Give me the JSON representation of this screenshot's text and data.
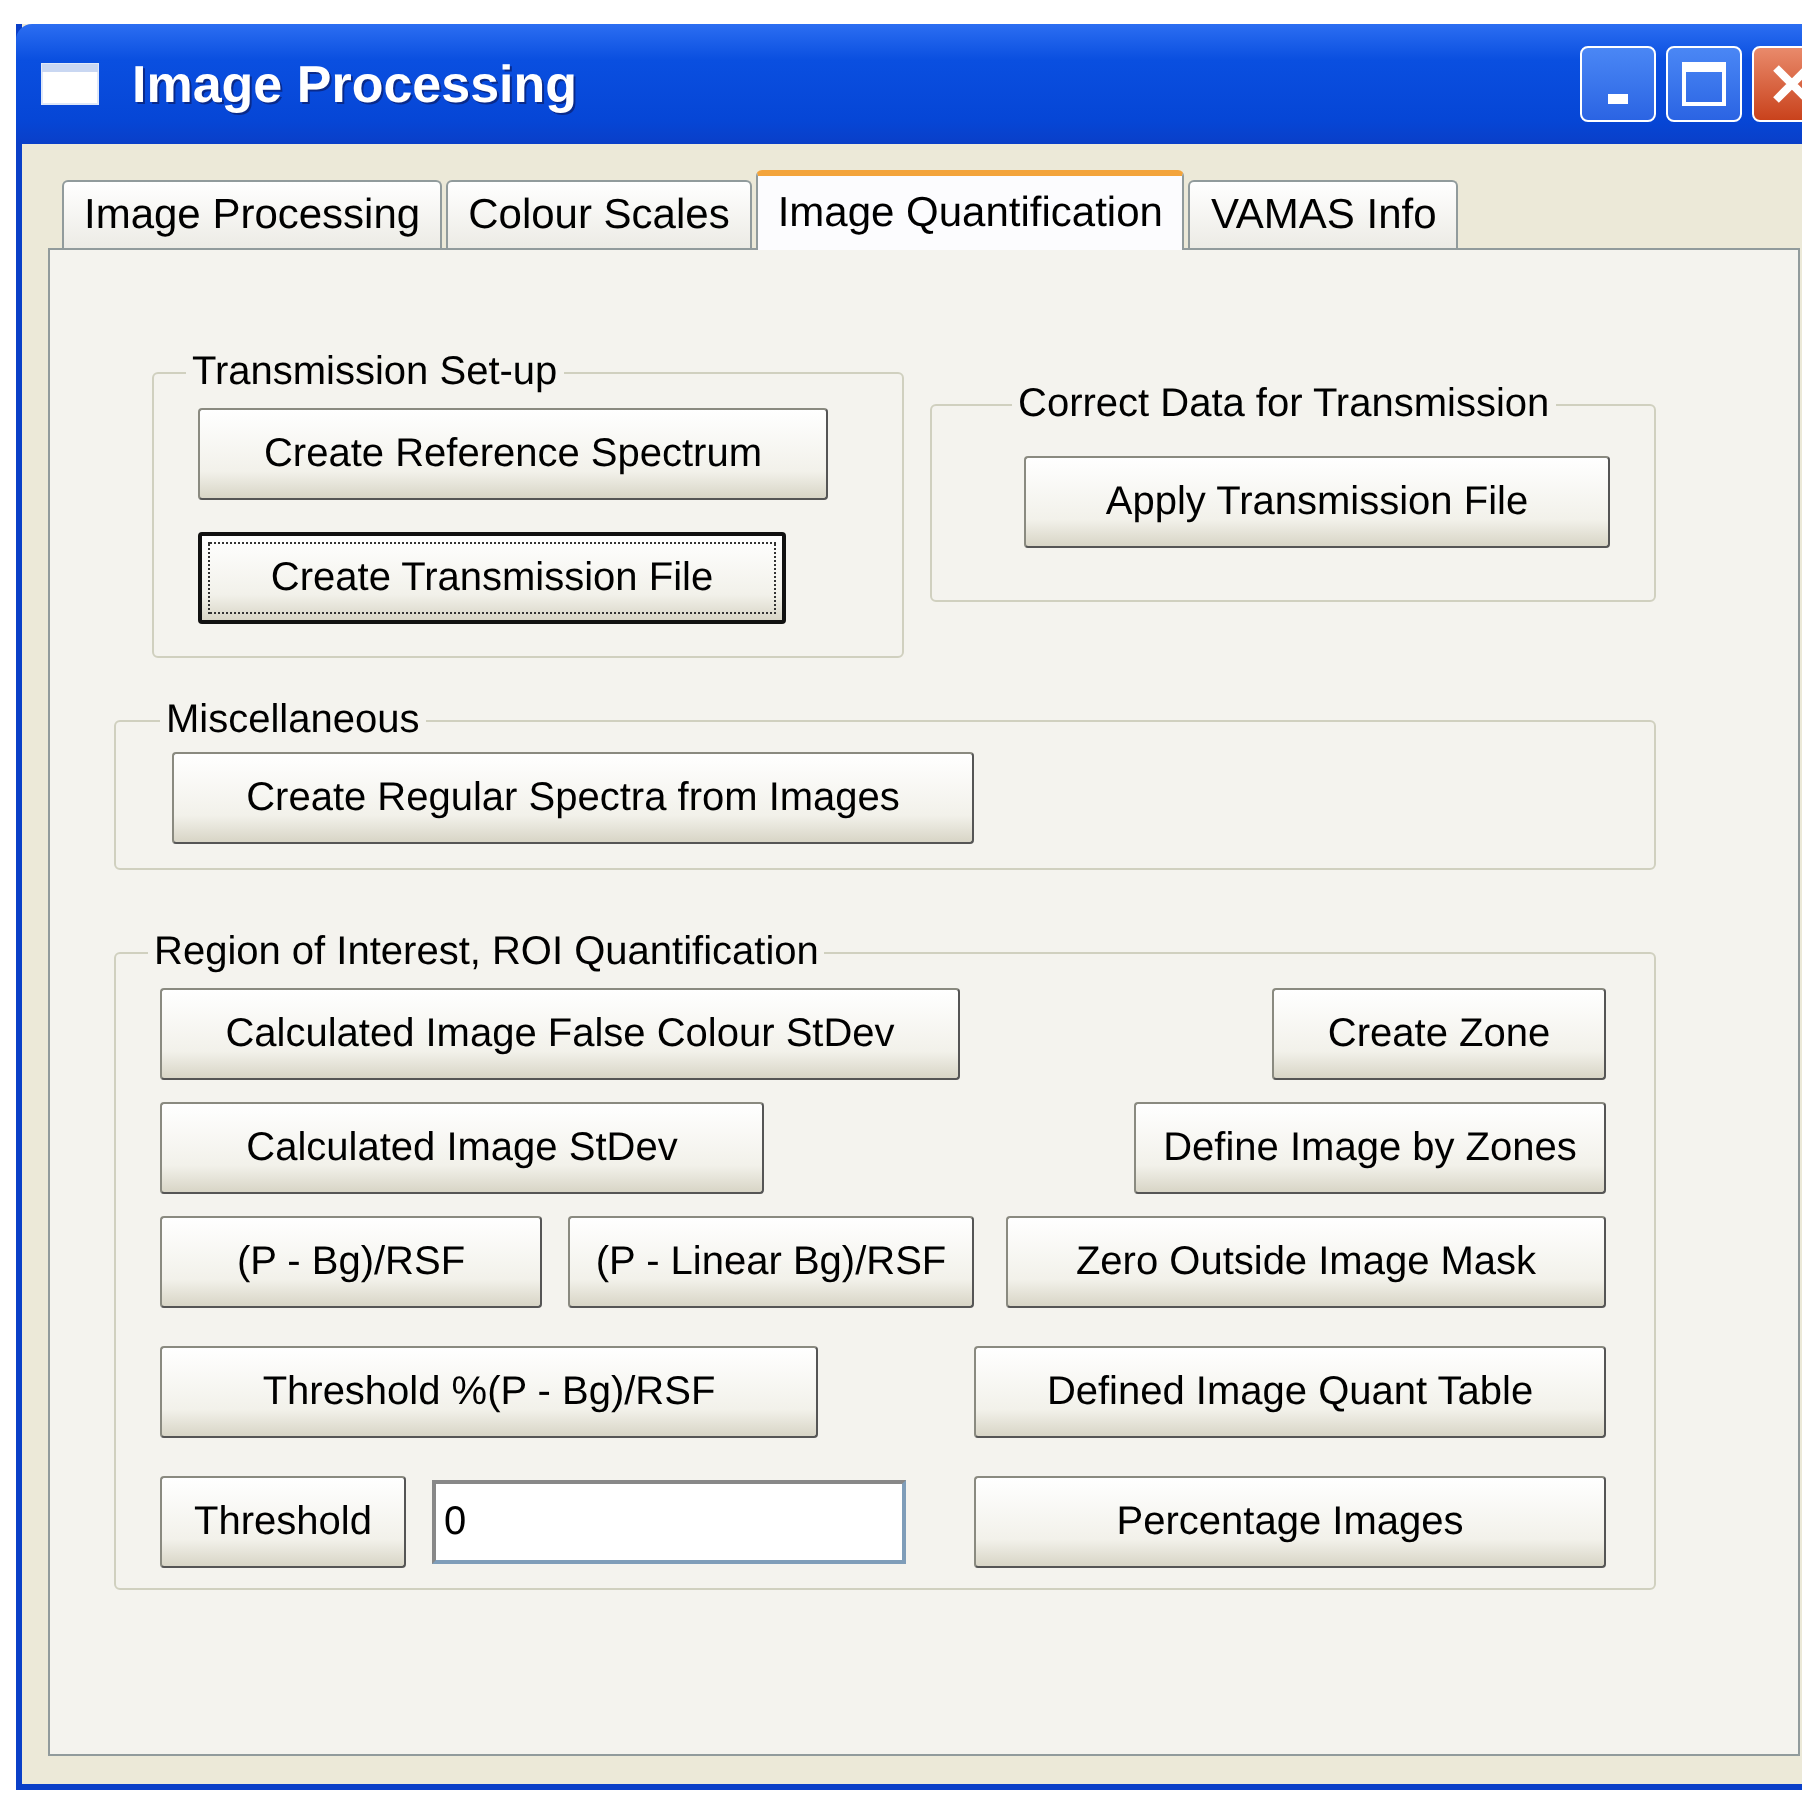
{
  "window": {
    "title": "Image Processing"
  },
  "tabs": [
    {
      "label": "Image Processing",
      "selected": false
    },
    {
      "label": "Colour Scales",
      "selected": false
    },
    {
      "label": "Image Quantification",
      "selected": true
    },
    {
      "label": "VAMAS Info",
      "selected": false
    }
  ],
  "groups": [
    {
      "title": "Transmission Set-up",
      "rows": [
        {
          "left": [
            {
              "kind": "button",
              "label": "Create Reference Spectrum",
              "focused": false
            }
          ],
          "right": []
        },
        {
          "left": [
            {
              "kind": "button",
              "label": "Create Transmission File",
              "focused": true
            }
          ],
          "right": []
        }
      ]
    },
    {
      "title": "Correct Data for Transmission",
      "rows": [
        {
          "left": [
            {
              "kind": "button",
              "label": "Apply Transmission File",
              "focused": false
            }
          ],
          "right": []
        }
      ]
    },
    {
      "title": "Miscellaneous",
      "rows": [
        {
          "left": [
            {
              "kind": "button",
              "label": "Create Regular Spectra from Images",
              "focused": false
            }
          ],
          "right": []
        }
      ]
    },
    {
      "title": "Region of Interest, ROI Quantification",
      "rows": [
        {
          "left": [
            {
              "kind": "button",
              "label": "Calculated Image False Colour StDev",
              "focused": false
            }
          ],
          "right": [
            {
              "kind": "button",
              "label": "Create Zone",
              "focused": false
            }
          ]
        },
        {
          "left": [
            {
              "kind": "button",
              "label": "Calculated Image StDev",
              "focused": false
            }
          ],
          "right": [
            {
              "kind": "button",
              "label": "Define Image by Zones",
              "focused": false
            }
          ]
        },
        {
          "left": [
            {
              "kind": "button",
              "label": "(P - Bg)/RSF",
              "focused": false
            },
            {
              "kind": "button",
              "label": "(P - Linear Bg)/RSF",
              "focused": false
            }
          ],
          "right": [
            {
              "kind": "button",
              "label": "Zero Outside Image Mask",
              "focused": false
            }
          ]
        },
        {
          "left": [
            {
              "kind": "button",
              "label": "Threshold %(P - Bg)/RSF",
              "focused": false
            }
          ],
          "right": [
            {
              "kind": "button",
              "label": "Defined Image Quant Table",
              "focused": false
            }
          ]
        },
        {
          "left": [
            {
              "kind": "button",
              "label": "Threshold",
              "focused": false
            },
            {
              "kind": "field",
              "value": "0"
            }
          ],
          "right": [
            {
              "kind": "button",
              "label": "Percentage Images",
              "focused": false
            }
          ]
        }
      ]
    }
  ]
}
